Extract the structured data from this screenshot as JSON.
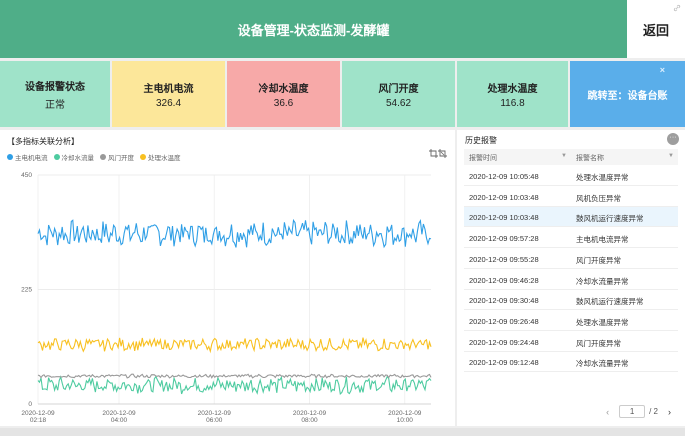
{
  "header": {
    "title": "设备管理-状态监测-发酵罐",
    "back_label": "返回"
  },
  "cards": [
    {
      "title": "设备报警状态",
      "value": "正常"
    },
    {
      "title": "主电机电流",
      "value": "326.4"
    },
    {
      "title": "冷却水温度",
      "value": "36.6"
    },
    {
      "title": "风门开度",
      "value": "54.62"
    },
    {
      "title": "处理水温度",
      "value": "116.8"
    }
  ],
  "jump_card": {
    "label": "跳转至：设备台账",
    "close": "×"
  },
  "chart_panel": {
    "title": "【多指标关联分析】"
  },
  "chart_data": {
    "type": "line",
    "title": "",
    "ylim": [
      0,
      450
    ],
    "y_ticks": [
      "0",
      "225",
      "450"
    ],
    "x_ticks": [
      {
        "date": "2020-12-09",
        "time": "02:18"
      },
      {
        "date": "2020-12-09",
        "time": "04:00"
      },
      {
        "date": "2020-12-09",
        "time": "06:00"
      },
      {
        "date": "2020-12-09",
        "time": "08:00"
      },
      {
        "date": "2020-12-09",
        "time": "10:00"
      }
    ],
    "x_range_hours": [
      2.3,
      10.55
    ],
    "grid": true,
    "legend_position": "top-left",
    "series": [
      {
        "name": "主电机电流",
        "color": "#2f9fe6",
        "mean": 335,
        "amplitude": 22
      },
      {
        "name": "冷却水流量",
        "color": "#4ecba0",
        "mean": 37,
        "amplitude": 14
      },
      {
        "name": "风门开度",
        "color": "#999999",
        "mean": 55,
        "amplitude": 3
      },
      {
        "name": "处理水温度",
        "color": "#f8c020",
        "mean": 117,
        "amplitude": 11
      }
    ]
  },
  "alarm_panel": {
    "title": "历史报警",
    "more": "···",
    "columns": [
      "报警时间",
      "报警名称"
    ],
    "rows": [
      {
        "time": "2020-12-09 10:05:48",
        "name": "处理水温度异常"
      },
      {
        "time": "2020-12-09 10:03:48",
        "name": "风机负压异常"
      },
      {
        "time": "2020-12-09 10:03:48",
        "name": "鼓风机运行速度异常"
      },
      {
        "time": "2020-12-09 09:57:28",
        "name": "主电机电流异常"
      },
      {
        "time": "2020-12-09 09:55:28",
        "name": "风门开度异常"
      },
      {
        "time": "2020-12-09 09:46:28",
        "name": "冷却水流量异常"
      },
      {
        "time": "2020-12-09 09:30:48",
        "name": "鼓风机运行速度异常"
      },
      {
        "time": "2020-12-09 09:26:48",
        "name": "处理水温度异常"
      },
      {
        "time": "2020-12-09 09:24:48",
        "name": "风门开度异常"
      },
      {
        "time": "2020-12-09 09:12:48",
        "name": "冷却水流量异常"
      }
    ],
    "highlight_row": 2,
    "pager": {
      "current": "1",
      "total": "/ 2",
      "prev": "‹",
      "next": "›"
    }
  }
}
